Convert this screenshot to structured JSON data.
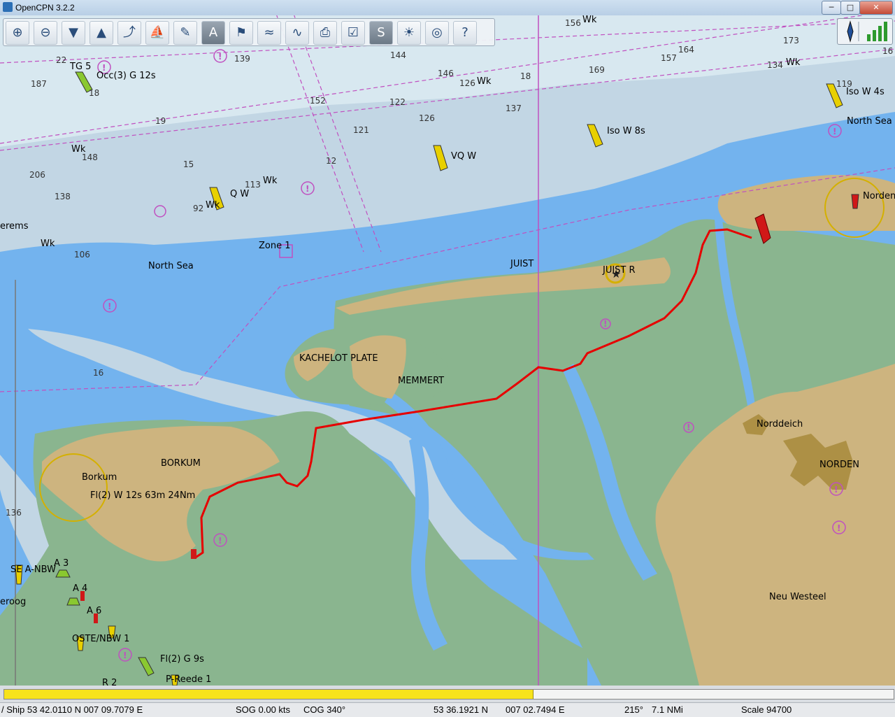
{
  "window": {
    "title": "OpenCPN 3.2.2",
    "min": "─",
    "max": "□",
    "close": "✕"
  },
  "toolbar": {
    "buttons": [
      {
        "name": "zoom-in",
        "glyph": "⊕"
      },
      {
        "name": "zoom-out",
        "glyph": "⊖"
      },
      {
        "name": "scale-in",
        "glyph": "▼"
      },
      {
        "name": "scale-out",
        "glyph": "▲"
      },
      {
        "name": "route",
        "glyph": "⤴"
      },
      {
        "name": "auto-follow",
        "glyph": "⛵"
      },
      {
        "name": "settings",
        "glyph": "✎"
      },
      {
        "name": "text",
        "glyph": "A"
      },
      {
        "name": "current",
        "glyph": "⚑"
      },
      {
        "name": "tide",
        "glyph": "≈"
      },
      {
        "name": "current-2",
        "glyph": "∿"
      },
      {
        "name": "print",
        "glyph": "⎙"
      },
      {
        "name": "route-manager",
        "glyph": "☑"
      },
      {
        "name": "track",
        "glyph": "S"
      },
      {
        "name": "colour-scheme",
        "glyph": "☀"
      },
      {
        "name": "mob",
        "glyph": "◎"
      },
      {
        "name": "help",
        "glyph": "?"
      }
    ],
    "active_index": 7
  },
  "status": {
    "ship": "/ Ship 53 42.0110 N   007 09.7079 E",
    "sog": "SOG 0.00 kts",
    "cog": "COG 340°",
    "cursor_lat": "53 36.1921 N",
    "cursor_lon": "007 02.7494 E",
    "bearing": "215°",
    "distance": "7.1 NMi",
    "scale": "Scale 94700"
  },
  "progress_fraction": 0.594,
  "labels": {
    "north_sea_1": "North Sea",
    "north_sea_2": "North Sea",
    "juist": "JUIST",
    "juist_r": "JUIST  R",
    "kachelot": "KACHELOT PLATE",
    "memmert": "MEMMERT",
    "borkum": "BORKUM",
    "borkum_lt": "Borkum",
    "borkum_light": "Fl(2) W 12s 63m 24Nm",
    "norddeich": "Norddeich",
    "norden": "NORDEN",
    "norden_lt": "Norden",
    "neu_westeel": "Neu Westeel",
    "zone1": "Zone 1",
    "tg5": "TG 5",
    "occ": "Occ(3) G 12s",
    "vqw": "VQ W",
    "qw": "Q W",
    "iso8": "Iso W 8s",
    "iso4": "Iso W 4s",
    "erems": "erems",
    "a3": "A 3",
    "a4": "A 4",
    "a6": "A 6",
    "snbw": "SE A-NBW",
    "oste": "OSTE/NBW 1",
    "flg": "Fl(2) G 9s",
    "preede": "P-Reede 1",
    "r2": "R 2",
    "eroog": "eroog",
    "wk": "Wk"
  },
  "soundings": [
    "22",
    "187",
    "18",
    "19",
    "148",
    "206",
    "138",
    "106",
    "15",
    "92",
    "113",
    "152",
    "122",
    "126",
    "121",
    "12",
    "144",
    "146",
    "126",
    "16",
    "156",
    "169",
    "18",
    "137",
    "157",
    "164",
    "173",
    "134",
    "119",
    "16",
    "136",
    "139"
  ],
  "colors": {
    "deep": "#d8e8f0",
    "mid": "#c2d6e4",
    "shallow": "#73b3ee",
    "drying": "#8ab58f",
    "land": "#cdb47f",
    "town": "#ad9045",
    "track": "#e60000",
    "magenta": "#c050c0"
  }
}
